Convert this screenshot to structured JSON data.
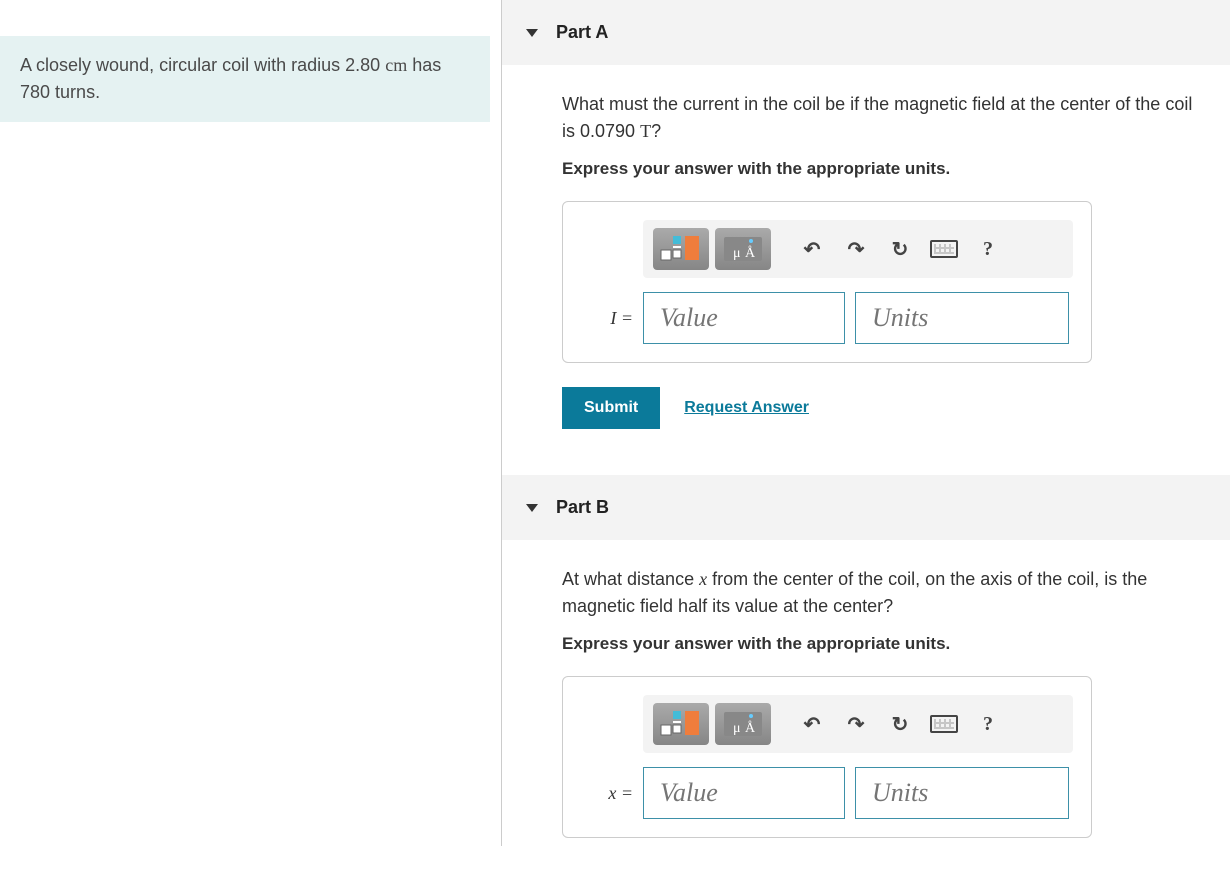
{
  "problem": {
    "text_before_radius": "A closely wound, circular coil with radius ",
    "radius_value": "2.80",
    "radius_unit": "cm",
    "text_after_radius": " has ",
    "turns": "780",
    "text_after_turns": " turns."
  },
  "parts": [
    {
      "label": "Part A",
      "question_pre": "What must the current in the coil be if the magnetic field at the center of the coil is ",
      "field_value": "0.0790",
      "field_unit": "T",
      "question_post": "?",
      "instruction": "Express your answer with the appropriate units.",
      "variable": "I",
      "value_placeholder": "Value",
      "units_placeholder": "Units",
      "submit_label": "Submit",
      "request_label": "Request Answer"
    },
    {
      "label": "Part B",
      "question_pre": "At what distance ",
      "var_inline": "x",
      "question_mid": " from the center of the coil, on the axis of the coil, is the magnetic field half its value at the center?",
      "instruction": "Express your answer with the appropriate units.",
      "variable": "x",
      "value_placeholder": "Value",
      "units_placeholder": "Units"
    }
  ],
  "toolbar": {
    "undo_glyph": "↶",
    "redo_glyph": "↷",
    "reset_glyph": "↻",
    "help_glyph": "?"
  }
}
